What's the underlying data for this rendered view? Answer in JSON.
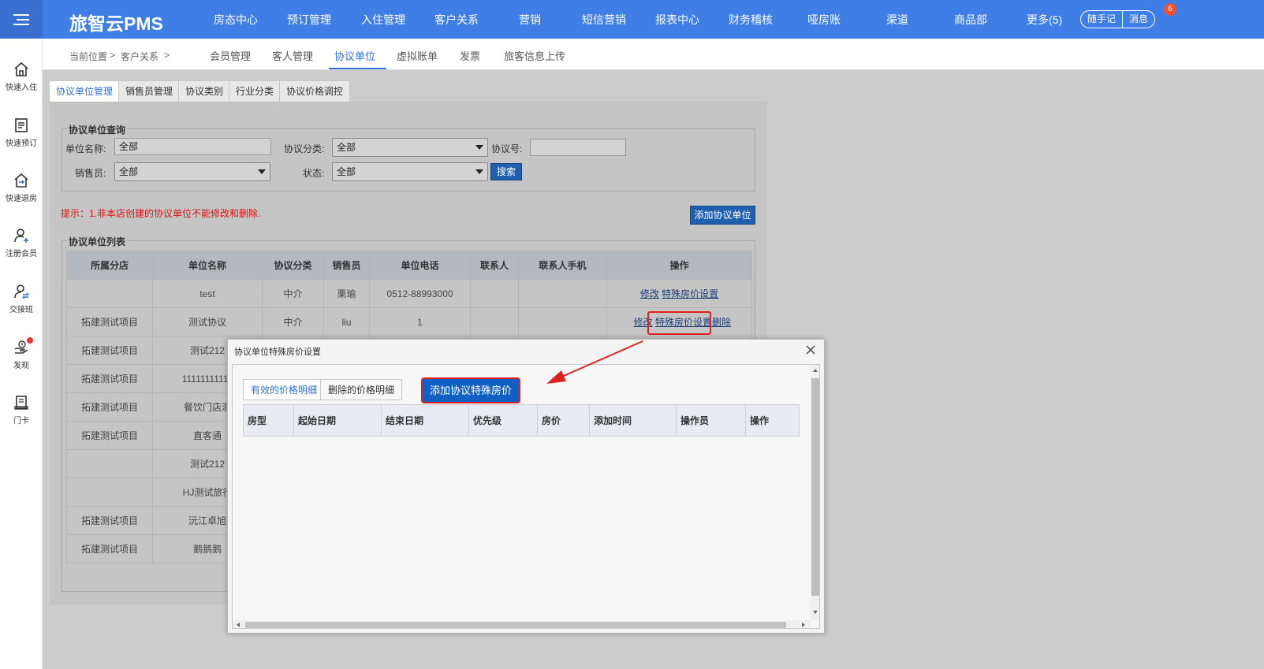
{
  "header": {
    "logo": "旅智云PMS",
    "nav": [
      "房态中心",
      "预订管理",
      "入住管理",
      "客户关系",
      "营销",
      "短信营销",
      "报表中心",
      "财务稽核",
      "哑房账",
      "渠道",
      "商品部",
      "更多(5)"
    ],
    "notes_button": "随手记",
    "messages_button": "消息",
    "messages_badge": "6"
  },
  "sidebar": {
    "items": [
      {
        "label": "快速入住",
        "icon": "home-icon"
      },
      {
        "label": "快速预订",
        "icon": "document-icon"
      },
      {
        "label": "快速退房",
        "icon": "checkout-icon"
      },
      {
        "label": "注册会员",
        "icon": "add-user-icon"
      },
      {
        "label": "交接班",
        "icon": "shift-handover-icon"
      },
      {
        "label": "发现",
        "icon": "discover-icon"
      },
      {
        "label": "门卡",
        "icon": "door-card-icon"
      }
    ]
  },
  "breadcrumb": {
    "prefix": "当前位置",
    "sep": ">",
    "current": "客户关系",
    "sep2": ">"
  },
  "subtabs": [
    "会员管理",
    "客人管理",
    "协议单位",
    "虚拟账单",
    "发票",
    "旅客信息上传"
  ],
  "inner_tabs": [
    "协议单位管理",
    "销售员管理",
    "协议类别",
    "行业分类",
    "协议价格调控"
  ],
  "query": {
    "legend": "协议单位查询",
    "unit_name_label": "单位名称:",
    "unit_name_value": "全部",
    "category_label": "协议分类:",
    "category_value": "全部",
    "agreement_no_label": "协议号:",
    "agreement_no_value": "",
    "salesperson_label": "销售员:",
    "salesperson_value": "全部",
    "status_label": "状态:",
    "status_value": "全部",
    "search_button": "搜索"
  },
  "hint": "提示：1.非本店创建的协议单位不能修改和删除.",
  "add_unit_button": "添加协议单位",
  "list": {
    "legend": "协议单位列表",
    "columns": [
      "所属分店",
      "单位名称",
      "协议分类",
      "销售员",
      "单位电话",
      "联系人",
      "联系人手机",
      "操作"
    ],
    "rows": [
      {
        "branch": "",
        "name": "test",
        "category": "中介",
        "sales": "栗瑜",
        "phone": "0512-88993000",
        "contact": "",
        "mobile": "",
        "ops": [
          "修改",
          "特殊房价设置"
        ]
      },
      {
        "branch": "拓建测试项目",
        "name": "测试协议",
        "category": "中介",
        "sales": "liu",
        "phone": "1",
        "contact": "",
        "mobile": "",
        "ops": [
          "修改",
          "特殊房价设置",
          "删除"
        ]
      },
      {
        "branch": "拓建测试项目",
        "name": "测试212"
      },
      {
        "branch": "拓建测试项目",
        "name": "11111111111"
      },
      {
        "branch": "拓建测试项目",
        "name": "餐饮门店测"
      },
      {
        "branch": "拓建测试项目",
        "name": "直客通"
      },
      {
        "branch": "",
        "name": "测试212"
      },
      {
        "branch": "",
        "name": "HJ测试旅行"
      },
      {
        "branch": "拓建测试项目",
        "name": "沅江卓旭"
      },
      {
        "branch": "拓建测试项目",
        "name": "鹅鹅鹅"
      }
    ]
  },
  "dialog": {
    "title": "协议单位特殊房价设置",
    "tabs": [
      "有效的价格明细",
      "删除的价格明细"
    ],
    "add_button": "添加协议特殊房价",
    "columns": [
      "房型",
      "起始日期",
      "结束日期",
      "优先级",
      "房价",
      "添加时间",
      "操作员",
      "操作"
    ]
  }
}
